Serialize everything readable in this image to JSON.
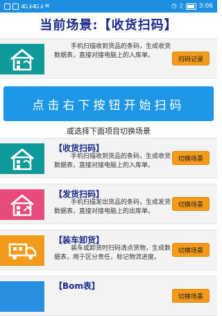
{
  "status_bar": {
    "left_signal": "4G .ıl 4G .ıl",
    "time": "3:06"
  },
  "page_title": "当前场景:【收货扫码】",
  "current_card": {
    "desc": "手机扫描收到货品的条码，生成收货数据表，直接对接电脑上的入库单。",
    "button_label": "扫码记录",
    "icon": "house-icon",
    "icon_color": "#0e9a9a"
  },
  "start_button_label": "点击右下按钮开始扫码",
  "switch_hint": "或选择下面项目切换场景",
  "scenes": [
    {
      "title": "【收货扫码】",
      "desc": "手机扫描收到货品的条码，生成收货数据表，直接对接电脑上的入库单。",
      "button_label": "切换场景",
      "icon": "house-receive-icon",
      "icon_color": "#0e9a9a"
    },
    {
      "title": "【发货扫码】",
      "desc": "手机扫描发出货品的条码，生成发货数据表，直接对接电脑上的出库单。",
      "button_label": "切换场景",
      "icon": "house-ship-icon",
      "icon_color": "#e84a7a"
    },
    {
      "title": "【装车卸货】",
      "desc": "装车或卸货时扫码清点货物，生成数据表，用于区分责任，标记物流进度。",
      "button_label": "切换场景",
      "icon": "truck-icon",
      "icon_color": "#f39a1a"
    },
    {
      "title": "【Bom表】",
      "button_label": "切换场景",
      "icon": "bom-icon",
      "icon_color": "#2a8fe0"
    }
  ]
}
